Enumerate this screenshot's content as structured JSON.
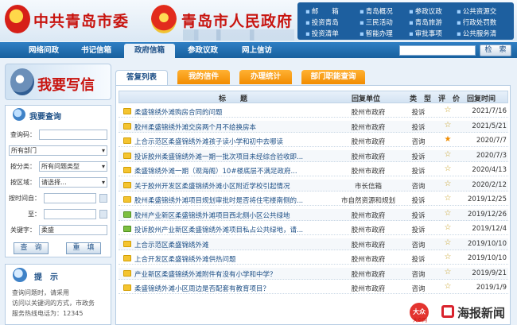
{
  "header": {
    "party_title": "中共青岛市委",
    "gov_title": "青岛市人民政府",
    "quick_links": [
      "邮　　箱",
      "青岛概况",
      "参政议政",
      "公共资源交",
      "投资青岛",
      "三民活动",
      "青岛旅游",
      "行政处罚数",
      "投资清单",
      "智能办理",
      "审批事项",
      "公共服务清"
    ]
  },
  "nav": {
    "tabs": [
      "网络问政",
      "书记信箱",
      "政府信箱",
      "参政议政",
      "网上信访"
    ],
    "active_tab": "政府信箱",
    "search_placeholder": "",
    "search_button": "检　索"
  },
  "sidebar": {
    "write_label": "我要写信",
    "query_title": "我要查询",
    "fields": [
      {
        "label": "查询码：",
        "value": ""
      },
      {
        "label": "",
        "value": "所有部门"
      },
      {
        "label": "按分类：",
        "value": "所有问题类型"
      },
      {
        "label": "按区域：",
        "value": "请选择..."
      },
      {
        "label": "按时间自：",
        "value": ""
      },
      {
        "label": "至：",
        "value": ""
      },
      {
        "label": "关键字：",
        "value": "柔盛"
      }
    ],
    "query_button": "查　询",
    "reset_button": "重　填",
    "tips_title": "提　示",
    "tips_lines": [
      "查询问题时，请采用",
      "访问以关键词的方式，市政务",
      "服务热线电话为：12345"
    ]
  },
  "main": {
    "tabs": [
      "答复列表",
      "我的信件",
      "办理统计",
      "部门职能查询"
    ],
    "active_tab": "答复列表",
    "columns": [
      "标　　题",
      "回复单位",
      "类　型",
      "评　价",
      "回复时间"
    ],
    "rows": [
      {
        "title": "柔盛锦绣外滩购房合同的问题",
        "unit": "胶州市政府",
        "type": "投诉",
        "rating": "empty",
        "date": "2021/7/16",
        "icon": "yellow"
      },
      {
        "title": "胶州柔盛锦绣外滩交房两个月不给换房本",
        "unit": "胶州市政府",
        "type": "投诉",
        "rating": "empty",
        "date": "2021/5/21",
        "icon": "yellow"
      },
      {
        "title": "上合示范区柔盛锦绣外滩孩子读小学和初中去哪读",
        "unit": "胶州市政府",
        "type": "咨询",
        "rating": "full",
        "date": "2020/7/7",
        "icon": "yellow"
      },
      {
        "title": "投诉胶州柔盛锦绣外滩一期一批次项目未经综合验收即...",
        "unit": "胶州市政府",
        "type": "投诉",
        "rating": "empty",
        "date": "2020/7/3",
        "icon": "yellow"
      },
      {
        "title": "柔盛锦绣外滩一期（观海阁）10#楼底层不满足政府...",
        "unit": "胶州市政府",
        "type": "投诉",
        "rating": "empty",
        "date": "2020/4/13",
        "icon": "yellow"
      },
      {
        "title": "关于胶州开发区柔盛锦绣外滩小区附近学校引起情况",
        "unit": "市长信箱",
        "type": "咨询",
        "rating": "empty",
        "date": "2020/2/12",
        "icon": "yellow"
      },
      {
        "title": "胶州柔盛锦绣外滩项目规划审批时是否将住宅楼南侧的...",
        "unit": "市自然资源和规划",
        "type": "投诉",
        "rating": "empty",
        "date": "2019/12/25",
        "icon": "yellow"
      },
      {
        "title": "胶州产业新区柔盛锦绣外滩项目西北侧小区公共绿地",
        "unit": "胶州市政府",
        "type": "投诉",
        "rating": "empty",
        "date": "2019/12/26",
        "icon": "green"
      },
      {
        "title": "投诉胶州产业新区柔盛锦绣外滩项目私占公共绿地，请...",
        "unit": "胶州市政府",
        "type": "投诉",
        "rating": "empty",
        "date": "2019/12/4",
        "icon": "green"
      },
      {
        "title": "上合示范区柔盛锦绣外滩",
        "unit": "胶州市政府",
        "type": "咨询",
        "rating": "empty",
        "date": "2019/10/10",
        "icon": "yellow"
      },
      {
        "title": "上合开发区柔盛锦绣外滩供热问题",
        "unit": "胶州市政府",
        "type": "投诉",
        "rating": "empty",
        "date": "2019/10/10",
        "icon": "yellow"
      },
      {
        "title": "产业新区柔盛锦绣外滩附件有没有小学和中学？",
        "unit": "胶州市政府",
        "type": "咨询",
        "rating": "empty",
        "date": "2019/9/21",
        "icon": "yellow"
      },
      {
        "title": "柔盛锦绣外滩小区周边是否配套有教育项目？",
        "unit": "胶州市政府",
        "type": "咨询",
        "rating": "empty",
        "date": "2019/1/9",
        "icon": "yellow"
      }
    ]
  },
  "watermark": {
    "logo": "大众",
    "sub": "大众网",
    "text": "海报新闻"
  },
  "colors": {
    "brand_red": "#c8140f",
    "nav_blue": "#18609e",
    "tab_orange": "#f28c00"
  }
}
